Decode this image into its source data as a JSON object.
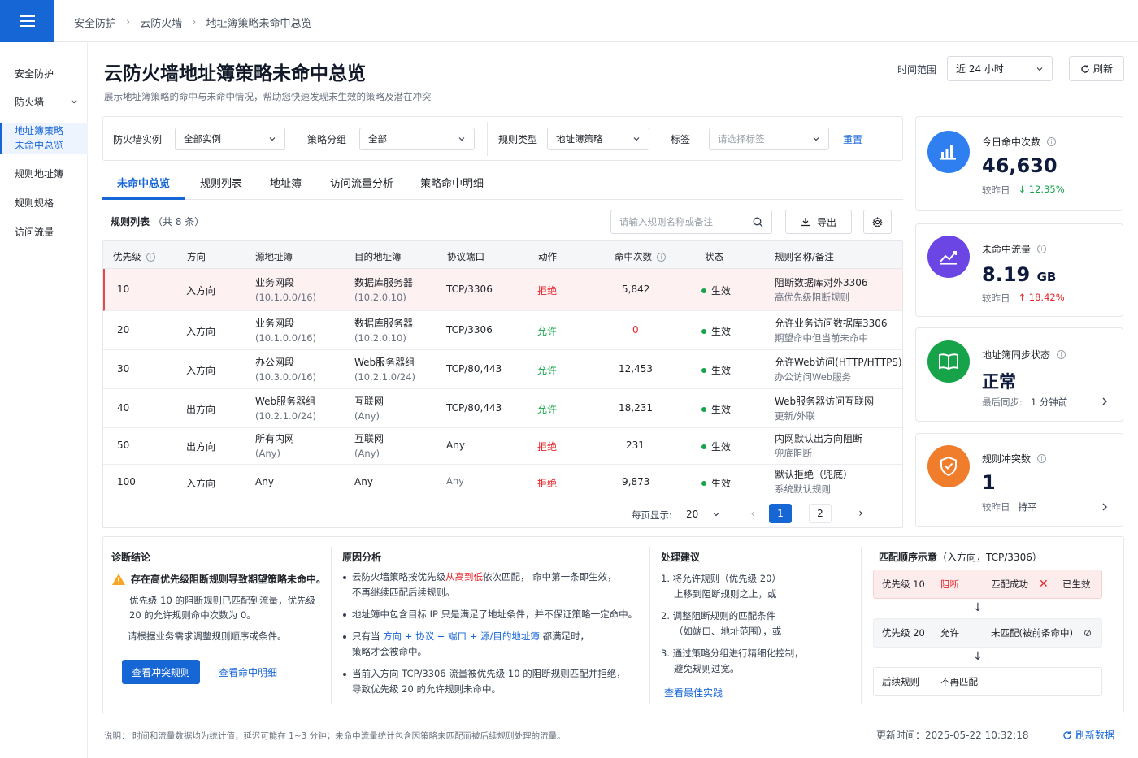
{
  "breadcrumb": [
    "安全防护",
    "云防火墙",
    "地址簿策略未命中总览"
  ],
  "sidebar": {
    "items": [
      {
        "label": "安全防护"
      },
      {
        "label": "防火墙"
      },
      {
        "label": "地址簿策略",
        "label2": "未命中总览"
      },
      {
        "label": "规则地址簿"
      },
      {
        "label": "规则规格"
      },
      {
        "label": "访问流量"
      }
    ]
  },
  "page": {
    "title": "云防火墙地址簿策略未命中总览",
    "subtitle": "展示地址簿策略的命中与未命中情况，帮助您快速发现未生效的策略及潜在冲突",
    "range_label": "时间范围",
    "range_value": "近 24 小时",
    "refresh": "刷新"
  },
  "filters": {
    "instance_label": "防火墙实例",
    "instance_value": "全部实例",
    "group_label": "策略分组",
    "group_value": "全部",
    "type_label": "规则类型",
    "type_value": "地址簿策略",
    "tag_label": "标签",
    "tag_placeholder": "请选择标签",
    "reset": "重置"
  },
  "tabs": [
    "未命中总览",
    "规则列表",
    "地址簿",
    "访问流量分析",
    "策略命中明细"
  ],
  "table": {
    "title": "规则列表",
    "count": "（共 8 条）",
    "search_placeholder": "请输入规则名称或备注",
    "export": "导出",
    "columns": [
      "优先级",
      "方向",
      "源地址簿",
      "目的地址簿",
      "协议端口",
      "动作",
      "命中次数",
      "状态",
      "规则名称/备注"
    ],
    "rows": [
      {
        "priority": "10",
        "direction": "入方向",
        "src": "业务网段",
        "src2": "(10.1.0.0/16)",
        "dst": "数据库服务器",
        "dst2": "(10.2.0.10)",
        "port": "TCP/3306",
        "action": "拒绝",
        "hits": "5,842",
        "status": "生效",
        "name": "阻断数据库对外3306",
        "remark": "高优先级阻断规则"
      },
      {
        "priority": "20",
        "direction": "入方向",
        "src": "业务网段",
        "src2": "(10.1.0.0/16)",
        "dst": "数据库服务器",
        "dst2": "(10.2.0.10)",
        "port": "TCP/3306",
        "action": "允许",
        "hits": "0",
        "status": "生效",
        "name": "允许业务访问数据库3306",
        "remark": "期望命中但当前未命中"
      },
      {
        "priority": "30",
        "direction": "入方向",
        "src": "办公网段",
        "src2": "(10.3.0.0/16)",
        "dst": "Web服务器组",
        "dst2": "(10.2.1.0/24)",
        "port": "TCP/80,443",
        "action": "允许",
        "hits": "12,453",
        "status": "生效",
        "name": "允许Web访问(HTTP/HTTPS)",
        "remark": "办公访问Web服务"
      },
      {
        "priority": "40",
        "direction": "出方向",
        "src": "Web服务器组",
        "src2": "(10.2.1.0/24)",
        "dst": "互联网",
        "dst2": "(Any)",
        "port": "TCP/80,443",
        "action": "允许",
        "hits": "18,231",
        "status": "生效",
        "name": "Web服务器访问互联网",
        "remark": "更新/外联"
      },
      {
        "priority": "50",
        "direction": "出方向",
        "src": "所有内网",
        "src2": "(Any)",
        "dst": "互联网",
        "dst2": "(Any)",
        "port": "Any",
        "action": "拒绝",
        "hits": "231",
        "status": "生效",
        "name": "内网默认出方向阻断",
        "remark": "兜底阻断"
      },
      {
        "priority": "100",
        "direction": "入方向",
        "src": "Any",
        "src2": "",
        "dst": "Any",
        "dst2": "",
        "port": "Any",
        "action": "拒绝",
        "hits": "9,873",
        "status": "生效",
        "name": "默认拒绝（兜底）",
        "remark": "系统默认规则"
      }
    ],
    "pager": {
      "label": "每页显示:",
      "size": "20",
      "pages": [
        "1",
        "2"
      ],
      "current": "1"
    }
  },
  "cards": [
    {
      "label": "今日命中次数",
      "value": "46,630",
      "unit": "",
      "foot_label": "较昨日",
      "foot_value": "↓ 12.35%",
      "color": "#2f7ff0"
    },
    {
      "label": "未命中流量",
      "value": "8.19",
      "unit": "GB",
      "foot_label": "较昨日",
      "foot_value": "↑ 18.42%",
      "color": "#6b46e5"
    },
    {
      "label": "地址簿同步状态",
      "value": "正常",
      "unit": "",
      "foot_label": "最后同步:",
      "foot_value": "1 分钟前",
      "color": "#17a34a"
    },
    {
      "label": "规则冲突数",
      "value": "1",
      "unit": "",
      "foot_label": "较昨日",
      "foot_value": "持平",
      "color": "#f07d2c"
    }
  ],
  "diagnosis": {
    "title": "诊断结论",
    "headline": "存在高优先级阻断规则导致期望策略未命中。",
    "p1a": "优先级 10 的阻断规则已匹配到流量，优先级",
    "p1b": "20 的允许规则命中次数为 0。",
    "p2": "请根据业务需求调整规则顺序或条件。",
    "btn": "查看冲突规则",
    "link": "查看命中明细"
  },
  "cause": {
    "title": "原因分析",
    "b1a": "云防火墙策略按优先级",
    "b1hl": "从高到低",
    "b1b": "依次匹配，  命中第一条即生效，",
    "b1c": "不再继续匹配后续规则。",
    "b2": "地址簿中包含目标 IP 只是满足了地址条件，并不保证策略一定命中。",
    "b3a": "只有当 ",
    "b3hl": "方向 + 协议 + 端口 + 源/目的地址簿",
    "b3b": " 都满足时，",
    "b3c": "策略才会被命中。",
    "b4a": "当前入方向 TCP/3306 流量被优先级 10 的阻断规则匹配并拒绝，",
    "b4b": "导致优先级 20 的允许规则未命中。"
  },
  "suggest": {
    "title": "处理建议",
    "s1a": "1.  将允许规则（优先级 20）",
    "s1b": "上移到阻断规则之上，或",
    "s2a": "2.  调整阻断规则的匹配条件",
    "s2b": "（如端口、地址范围），或",
    "s3a": "3.  通过策略分组进行精细化控制，",
    "s3b": "避免规则过宽。",
    "link": "查看最佳实践"
  },
  "match": {
    "title": "匹配顺序示意",
    "title_note": "（入方向，TCP/3306）",
    "r1": {
      "priority": "优先级 10",
      "action": "阻断",
      "result": "匹配成功",
      "state": "已生效"
    },
    "r2": {
      "priority": "优先级 20",
      "action": "允许",
      "result": "未匹配(被前条命中)"
    },
    "r3": {
      "priority": "后续规则",
      "action": "不再匹配"
    }
  },
  "footer": {
    "note": "说明：  时间和流量数据均为统计值，延迟可能在 1~3 分钟；未命中流量统计包含因策略未匹配而被后续规则处理的流量。",
    "updated_label": "更新时间：",
    "updated_value": "2025-05-22 10:32:18",
    "refresh": "刷新数据"
  }
}
